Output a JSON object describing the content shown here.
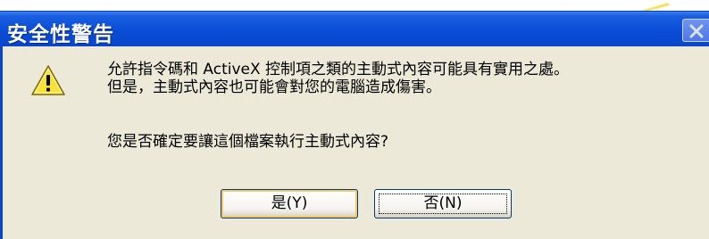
{
  "dialog": {
    "title": "安全性警告",
    "message_line1": "允許指令碼和 ActiveX 控制項之類的主動式內容可能具有實用之處。",
    "message_line2": "但是，主動式內容也可能會對您的電腦造成傷害。",
    "question": "您是否確定要讓這個檔案執行主動式內容?",
    "icon": "warning-icon"
  },
  "buttons": {
    "yes_label": "是(Y)",
    "no_label": "否(N)"
  },
  "colors": {
    "titlebar": "#0a46cc",
    "body": "#ece9d8",
    "button_border": "#003c74"
  }
}
